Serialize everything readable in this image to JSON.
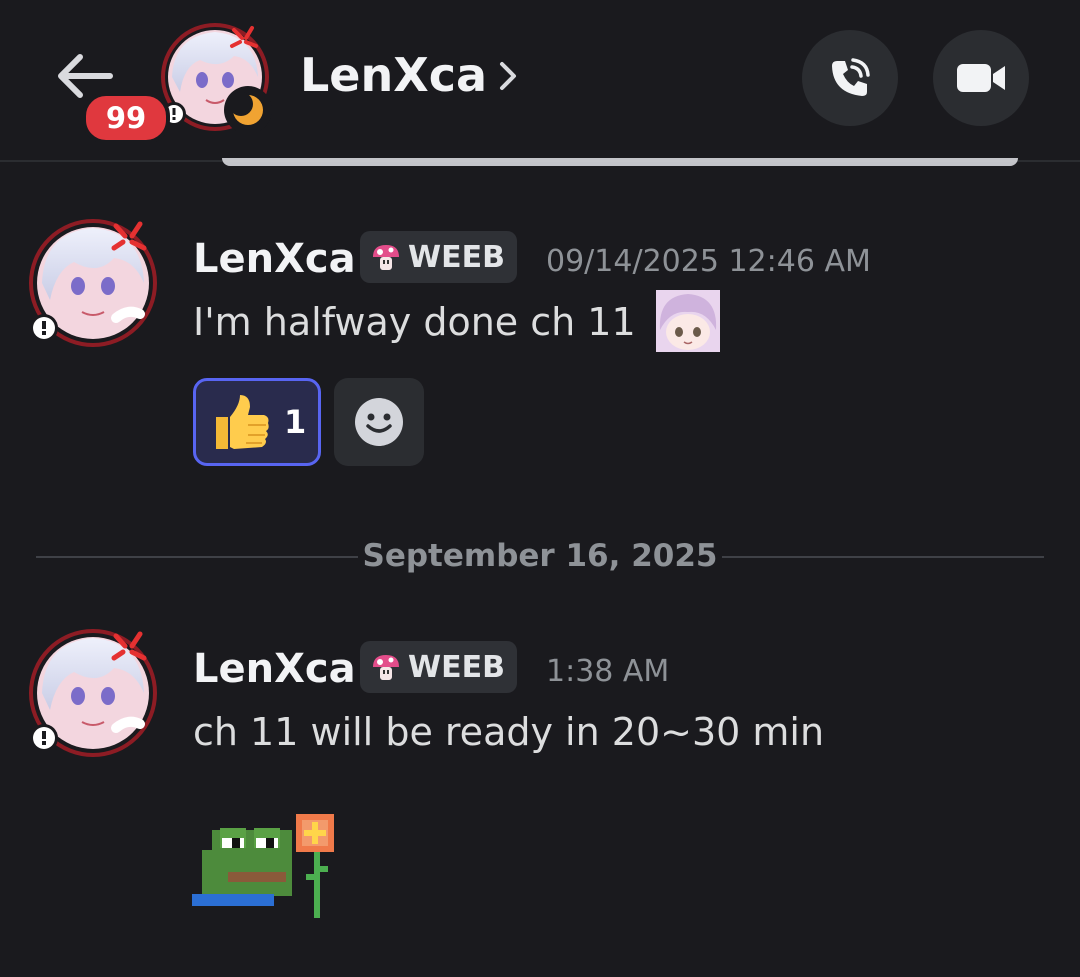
{
  "header": {
    "title": "LenXca",
    "unread_count": "99",
    "icons": [
      "back-arrow-icon",
      "chevron-right-icon",
      "phone-call-icon",
      "video-camera-icon",
      "moon-status-icon"
    ]
  },
  "messages": [
    {
      "author": "LenXca",
      "tag": "WEEB",
      "timestamp": "09/14/2025 12:46 AM",
      "text": "I'm halfway done ch 11",
      "reactions": [
        {
          "emoji": "thumbs-up",
          "count": "1"
        }
      ]
    },
    {
      "author": "LenXca",
      "tag": "WEEB",
      "timestamp": "1:38 AM",
      "text": "ch 11 will be ready in 20~30 min"
    }
  ],
  "divider": {
    "date": "September 16, 2025"
  },
  "colors": {
    "background": "#1a1a1e",
    "badge_red": "#e0383e",
    "reaction_accent": "#5865f2",
    "timestamp_gray": "#8e9297"
  }
}
